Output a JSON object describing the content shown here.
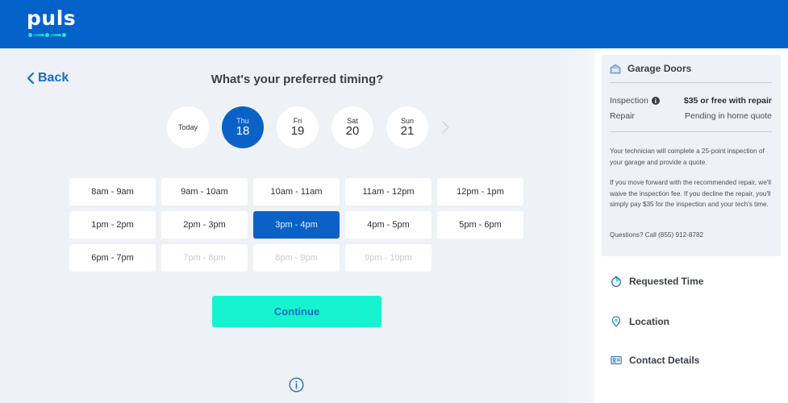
{
  "header": {
    "logo": "puls",
    "brand_color": "#0362c9",
    "accent_color": "#16f4cf"
  },
  "nav": {
    "back_label": "Back",
    "back_icon": "chevron-left-icon"
  },
  "main": {
    "title": "What's your preferred timing?",
    "days": [
      {
        "dow": "Today",
        "num": "",
        "selected": false
      },
      {
        "dow": "Thu",
        "num": "18",
        "selected": true
      },
      {
        "dow": "Fri",
        "num": "19",
        "selected": false
      },
      {
        "dow": "Sat",
        "num": "20",
        "selected": false
      },
      {
        "dow": "Sun",
        "num": "21",
        "selected": false
      }
    ],
    "next_icon": "chevron-right-icon",
    "slots": [
      {
        "label": "8am - 9am",
        "state": "available"
      },
      {
        "label": "9am - 10am",
        "state": "available"
      },
      {
        "label": "10am - 11am",
        "state": "available"
      },
      {
        "label": "11am - 12pm",
        "state": "available"
      },
      {
        "label": "12pm - 1pm",
        "state": "available"
      },
      {
        "label": "1pm - 2pm",
        "state": "available"
      },
      {
        "label": "2pm - 3pm",
        "state": "available"
      },
      {
        "label": "3pm - 4pm",
        "state": "selected"
      },
      {
        "label": "4pm - 5pm",
        "state": "available"
      },
      {
        "label": "5pm - 6pm",
        "state": "available"
      },
      {
        "label": "6pm - 7pm",
        "state": "available"
      },
      {
        "label": "7pm - 8pm",
        "state": "disabled"
      },
      {
        "label": "8pm - 9pm",
        "state": "disabled"
      },
      {
        "label": "9pm - 10pm",
        "state": "disabled"
      }
    ],
    "continue_label": "Continue",
    "info_icon": "info-circle-icon"
  },
  "sidebar": {
    "service": {
      "icon": "garage-icon",
      "title": "Garage Doors",
      "rows": [
        {
          "label": "Inspection",
          "value": "$35 or free with repair",
          "has_info": true
        },
        {
          "label": "Repair",
          "value": "Pending in home quote",
          "has_info": false
        }
      ],
      "paragraphs": [
        "Your technician will complete a 25-point inspection of your garage and provide a quote.",
        "If you move forward with the recommended repair, we'll waive the inspection fee. If you decline the repair, you'll simply pay $35 for the inspection and your tech's time.",
        "Questions? Call (855) 912-8782"
      ]
    },
    "steps": [
      {
        "icon": "stopwatch-icon",
        "label": "Requested Time"
      },
      {
        "icon": "location-pin-icon",
        "label": "Location"
      },
      {
        "icon": "contact-card-icon",
        "label": "Contact Details"
      }
    ]
  }
}
